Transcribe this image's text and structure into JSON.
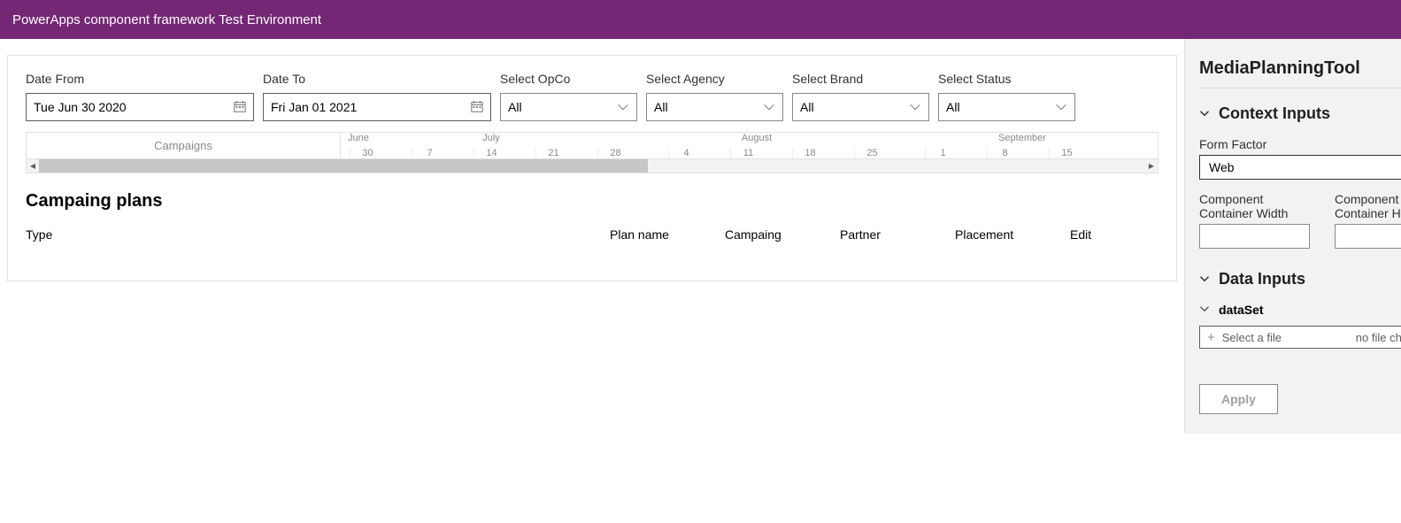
{
  "header": {
    "title": "PowerApps component framework Test Environment"
  },
  "filters": {
    "dateFrom": {
      "label": "Date From",
      "value": "Tue Jun 30 2020"
    },
    "dateTo": {
      "label": "Date To",
      "value": "Fri Jan 01 2021"
    },
    "opco": {
      "label": "Select OpCo",
      "value": "All"
    },
    "agency": {
      "label": "Select Agency",
      "value": "All"
    },
    "brand": {
      "label": "Select Brand",
      "value": "All"
    },
    "status": {
      "label": "Select Status",
      "value": "All"
    }
  },
  "timeline": {
    "leftLabel": "Campaigns",
    "months": [
      "June",
      "July",
      "August",
      "September"
    ],
    "days": [
      "30",
      "7",
      "14",
      "21",
      "28",
      "4",
      "11",
      "18",
      "25",
      "1",
      "8",
      "15"
    ]
  },
  "section": {
    "title": "Campaing plans",
    "columns": {
      "type": "Type",
      "planName": "Plan name",
      "campaign": "Campaing",
      "partner": "Partner",
      "placement": "Placement",
      "edit": "Edit"
    }
  },
  "sidebar": {
    "title": "MediaPlanningTool",
    "contextInputs": {
      "header": "Context Inputs",
      "formFactor": {
        "label": "Form Factor",
        "value": "Web"
      },
      "width": {
        "label": "Component Container Width",
        "value": ""
      },
      "height": {
        "label": "Component Container Height",
        "value": ""
      }
    },
    "dataInputs": {
      "header": "Data Inputs",
      "dataset": {
        "label": "dataSet",
        "placeholder": "Select a file",
        "status": "no file chosen"
      }
    },
    "applyLabel": "Apply"
  }
}
